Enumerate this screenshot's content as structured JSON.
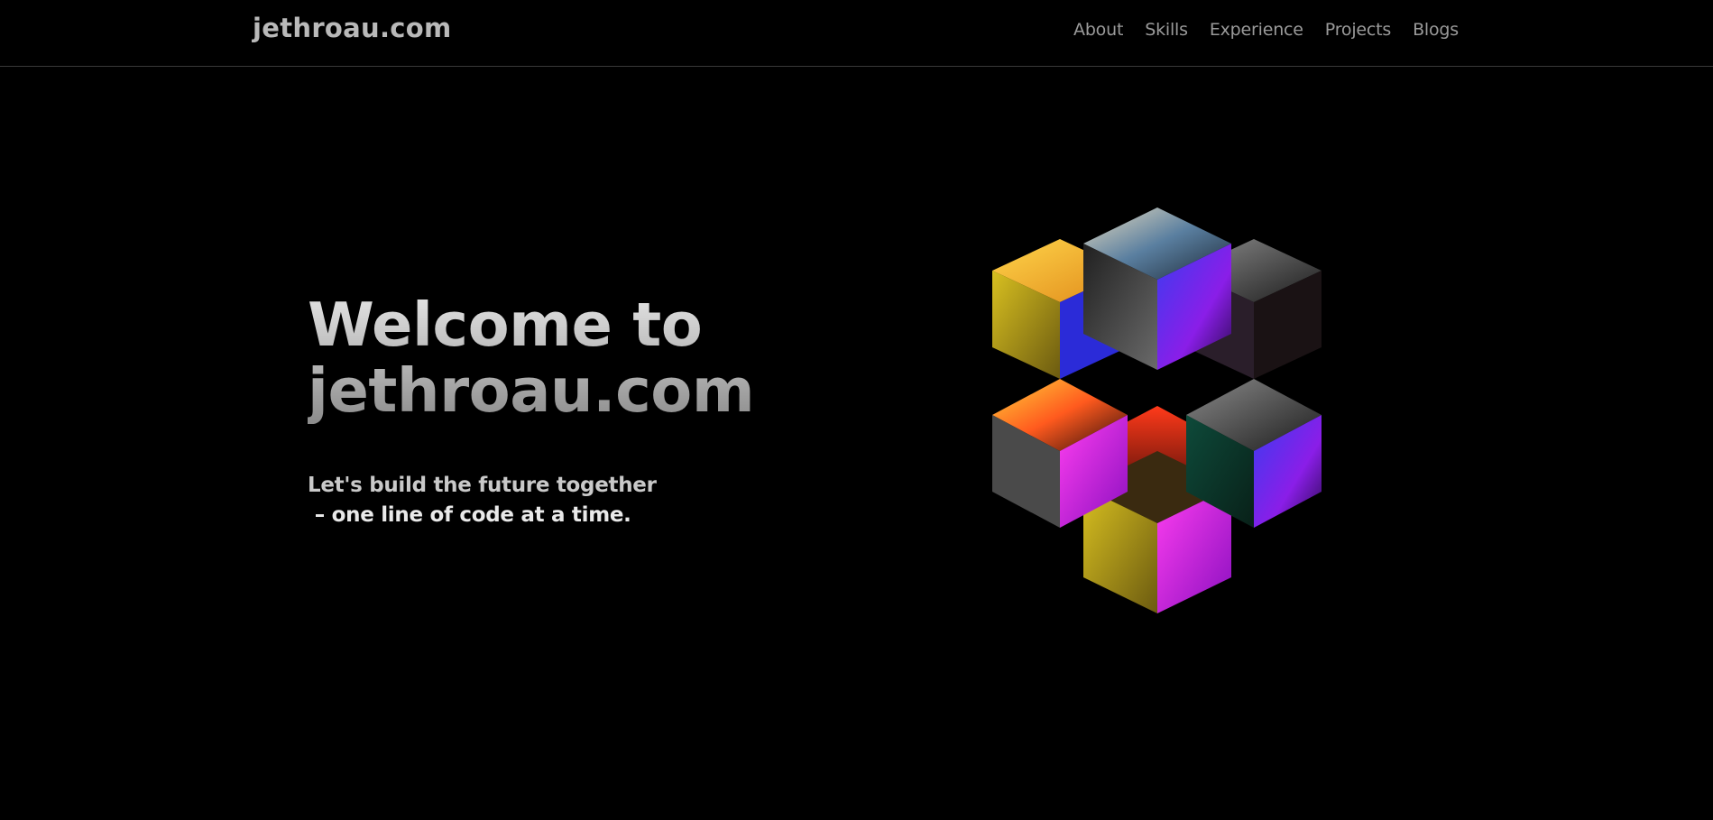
{
  "header": {
    "brand": "jethroau.com",
    "nav": [
      "About",
      "Skills",
      "Experience",
      "Projects",
      "Blogs"
    ]
  },
  "hero": {
    "title_line1": "Welcome to",
    "title_line2": "jethroau.com",
    "subtitle_line1": "Let's build the future together",
    "subtitle_line2": " – one line of code at a time."
  },
  "colors": {
    "background": "#000000",
    "nav_text": "#9a9a9a",
    "brand_text": "#b9b9b9"
  },
  "hero_image": "iridescent-cube-cluster-illustration"
}
